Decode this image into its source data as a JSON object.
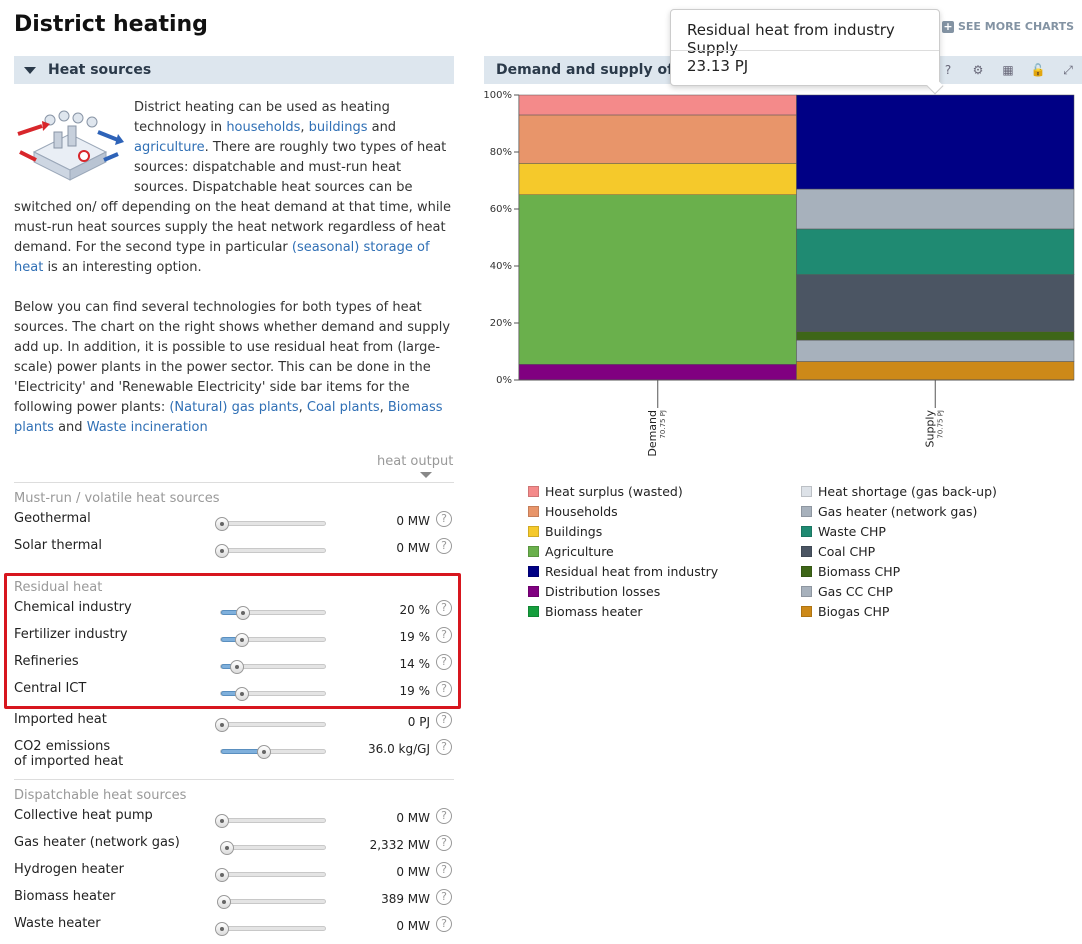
{
  "page": {
    "title": "District heating"
  },
  "heat_sources": {
    "header": "Heat sources",
    "intro_p1_before": "District heating can be used as heating technology in ",
    "link_households": "households",
    "sep1": ", ",
    "link_buildings": "buildings",
    "sep2": " and ",
    "link_agriculture": "agriculture",
    "intro_p1_after": ". There are roughly two types of heat sources: dispatchable and must-run heat sources. Dispatchable heat sources can be switched on/ off depending on the heat demand at that time, while must-run heat sources supply the heat network regardless of heat demand. For the second type in particular ",
    "link_storage": "(seasonal) storage of heat",
    "intro_p1_end": " is an interesting option.",
    "intro_p2": "Below you can find several technologies for both types of heat sources. The chart on the right shows whether demand and supply add up. In addition, it is possible to use residual heat from (large-scale) power plants in the power sector. This can be done in the 'Electricity' and 'Renewable Electricity' side bar items for the following power plants: ",
    "link_gas_plants": "(Natural) gas plants",
    "sep3": ", ",
    "link_coal_plants": "Coal plants",
    "sep4": ", ",
    "link_biomass_plants": "Biomass plants",
    "sep5": " and ",
    "link_waste": "Waste incineration",
    "heat_output_label": "heat output"
  },
  "must_run": {
    "title": "Must-run / volatile heat sources",
    "rows": [
      {
        "label": "Geothermal",
        "value": "0 MW",
        "level": 0
      },
      {
        "label": "Solar thermal",
        "value": "0 MW",
        "level": 0
      }
    ]
  },
  "residual": {
    "title": "Residual heat",
    "rows": [
      {
        "label": "Chemical industry",
        "value": "20 %",
        "level": 0.2
      },
      {
        "label": "Fertilizer industry",
        "value": "19 %",
        "level": 0.19
      },
      {
        "label": "Refineries",
        "value": "14 %",
        "level": 0.14
      },
      {
        "label": "Central ICT",
        "value": "19 %",
        "level": 0.19
      }
    ]
  },
  "imported": {
    "rows": [
      {
        "label": "Imported heat",
        "value": "0 PJ",
        "level": 0
      },
      {
        "label": "CO2 emissions of imported heat",
        "value": "36.0 kg/GJ",
        "level": 0.4
      }
    ]
  },
  "dispatchable": {
    "title": "Dispatchable heat sources",
    "rows": [
      {
        "label": "Collective heat pump",
        "value": "0 MW",
        "level": 0
      },
      {
        "label": "Gas heater (network gas)",
        "value": "2,332 MW",
        "level": 0.05
      },
      {
        "label": "Hydrogen heater",
        "value": "0 MW",
        "level": 0
      },
      {
        "label": "Biomass heater",
        "value": "389 MW",
        "level": 0.02
      },
      {
        "label": "Waste heater",
        "value": "0 MW",
        "level": 0
      }
    ]
  },
  "chart_panel": {
    "title": "Demand and supply of d",
    "see_more": "SEE MORE CHARTS",
    "tools": [
      "help-icon",
      "settings-icon",
      "table-icon",
      "lock-icon",
      "expand-icon"
    ],
    "tooltip_title": "Residual heat from industry Supply",
    "tooltip_value": "23.13 PJ"
  },
  "chart_data": {
    "type": "bar",
    "stacked": true,
    "percent": true,
    "categories": [
      "Demand",
      "Supply"
    ],
    "category_sublabels": [
      "70.75 PJ",
      "70.75 PJ"
    ],
    "ylim": [
      0,
      100
    ],
    "yticks": [
      "0%",
      "20%",
      "40%",
      "60%",
      "80%",
      "100%"
    ],
    "series": [
      {
        "name": "Distribution losses",
        "color": "#800080",
        "values": [
          5.5,
          0
        ]
      },
      {
        "name": "Agriculture",
        "color": "#6ab04c",
        "values": [
          59.5,
          0
        ]
      },
      {
        "name": "Buildings",
        "color": "#f5c92b",
        "values": [
          11,
          0
        ]
      },
      {
        "name": "Households",
        "color": "#e8956a",
        "values": [
          17,
          0
        ]
      },
      {
        "name": "Heat surplus (wasted)",
        "color": "#f48a8a",
        "values": [
          7,
          0
        ]
      },
      {
        "name": "Biogas CHP",
        "color": "#cd8918",
        "values": [
          0,
          6.5
        ]
      },
      {
        "name": "Gas CC CHP",
        "color": "#a7b1bc",
        "values": [
          0,
          7.5
        ]
      },
      {
        "name": "Biomass CHP",
        "color": "#3e6618",
        "values": [
          0,
          3
        ]
      },
      {
        "name": "Coal CHP",
        "color": "#4b5563",
        "values": [
          0,
          20
        ]
      },
      {
        "name": "Waste CHP",
        "color": "#1f8a72",
        "values": [
          0,
          16
        ]
      },
      {
        "name": "Gas heater (network gas)",
        "color": "#a7b1bc",
        "values": [
          0,
          14
        ]
      },
      {
        "name": "Residual heat from industry",
        "color": "#000085",
        "values": [
          0,
          33
        ]
      }
    ],
    "legend": [
      {
        "name": "Heat surplus (wasted)",
        "color": "#f48a8a"
      },
      {
        "name": "Households",
        "color": "#e8956a"
      },
      {
        "name": "Buildings",
        "color": "#f5c92b"
      },
      {
        "name": "Agriculture",
        "color": "#6ab04c"
      },
      {
        "name": "Residual heat from industry",
        "color": "#000085"
      },
      {
        "name": "Distribution losses",
        "color": "#800080"
      },
      {
        "name": "Biomass heater",
        "color": "#159e3d"
      },
      {
        "name": "Heat shortage (gas back-up)",
        "color": "#dde2e8"
      },
      {
        "name": "Gas heater (network gas)",
        "color": "#a7b1bc"
      },
      {
        "name": "Waste CHP",
        "color": "#1f8a72"
      },
      {
        "name": "Coal CHP",
        "color": "#4b5563"
      },
      {
        "name": "Biomass CHP",
        "color": "#3e6618"
      },
      {
        "name": "Gas CC CHP",
        "color": "#a7b1bc"
      },
      {
        "name": "Biogas CHP",
        "color": "#cd8918"
      }
    ]
  }
}
